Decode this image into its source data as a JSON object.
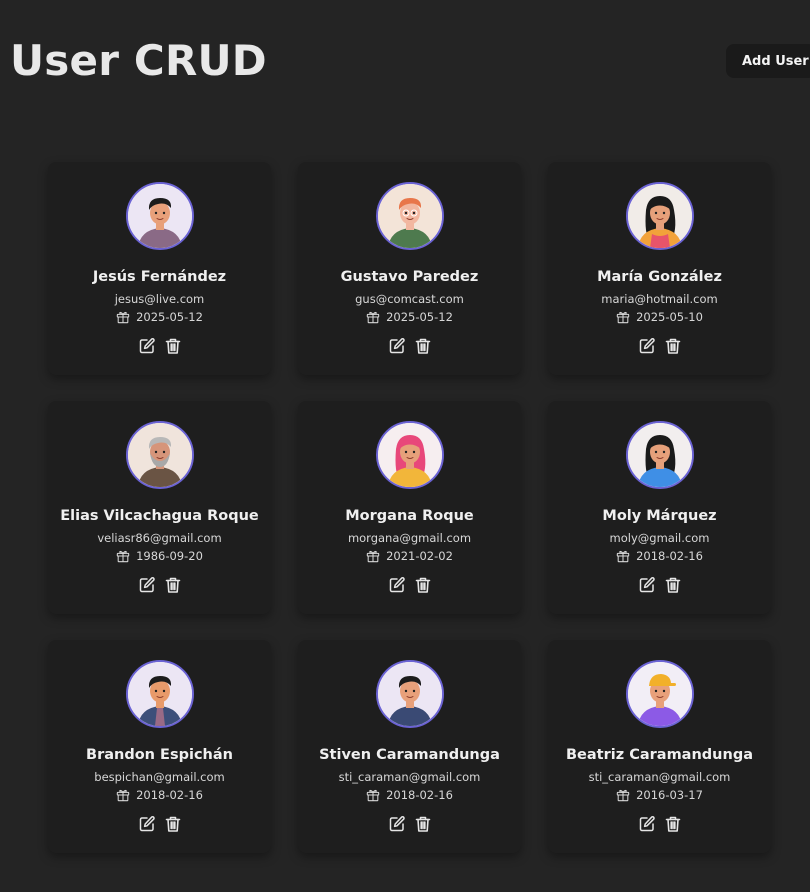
{
  "header": {
    "title": "User CRUD",
    "add_button_label": "Add User"
  },
  "users": [
    {
      "name": "Jesús Fernández",
      "email": "jesus@live.com",
      "birthday": "2025-05-12",
      "avatar": "male-dark-hair-purple-shirt-avatar"
    },
    {
      "name": "Gustavo Paredez",
      "email": "gus@comcast.com",
      "birthday": "2025-05-12",
      "avatar": "male-orange-hair-glasses-avatar"
    },
    {
      "name": "María González",
      "email": "maria@hotmail.com",
      "birthday": "2025-05-10",
      "avatar": "female-long-dark-hair-avatar"
    },
    {
      "name": "Elias Vilcachagua Roque",
      "email": "veliasr86@gmail.com",
      "birthday": "1986-09-20",
      "avatar": "older-male-gray-hair-avatar"
    },
    {
      "name": "Morgana Roque",
      "email": "morgana@gmail.com",
      "birthday": "2021-02-02",
      "avatar": "female-pink-hair-avatar"
    },
    {
      "name": "Moly Márquez",
      "email": "moly@gmail.com",
      "birthday": "2018-02-16",
      "avatar": "female-dark-hair-blue-shirt-avatar"
    },
    {
      "name": "Brandon Espichán",
      "email": "bespichan@gmail.com",
      "birthday": "2018-02-16",
      "avatar": "male-jacket-avatar"
    },
    {
      "name": "Stiven Caramandunga",
      "email": "sti_caraman@gmail.com",
      "birthday": "2018-02-16",
      "avatar": "male-navy-shirt-avatar"
    },
    {
      "name": "Beatriz Caramandunga",
      "email": "sti_caraman@gmail.com",
      "birthday": "2016-03-17",
      "avatar": "female-yellow-cap-avatar"
    }
  ],
  "icons": {
    "birthday": "gift-icon",
    "edit": "edit-icon",
    "delete": "trash-icon"
  },
  "colors": {
    "background": "#242424",
    "card": "#1e1e1e",
    "avatar_border": "#6b63d4",
    "button": "#1a1a1a"
  }
}
